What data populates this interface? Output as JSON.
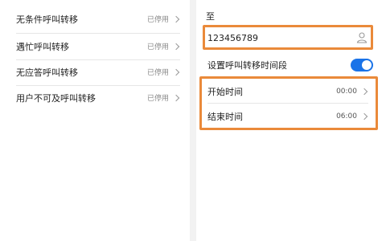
{
  "left_list": {
    "items": [
      {
        "label": "无条件呼叫转移",
        "status": "已停用"
      },
      {
        "label": "遇忙呼叫转移",
        "status": "已停用"
      },
      {
        "label": "无应答呼叫转移",
        "status": "已停用"
      },
      {
        "label": "用户不可及呼叫转移",
        "status": "已停用"
      }
    ]
  },
  "right_panel": {
    "to_label": "至",
    "phone_number": "123456789",
    "time_setting_label": "设置呼叫转移时间段",
    "time_setting_enabled": true,
    "start_time": {
      "label": "开始时间",
      "value": "00:00"
    },
    "end_time": {
      "label": "结束时间",
      "value": "06:00"
    }
  },
  "colors": {
    "highlight": "#ea8a3a",
    "toggle_on": "#1a73e8"
  },
  "icons": {
    "contact": "person-icon",
    "chevron": "chevron-right-icon"
  }
}
